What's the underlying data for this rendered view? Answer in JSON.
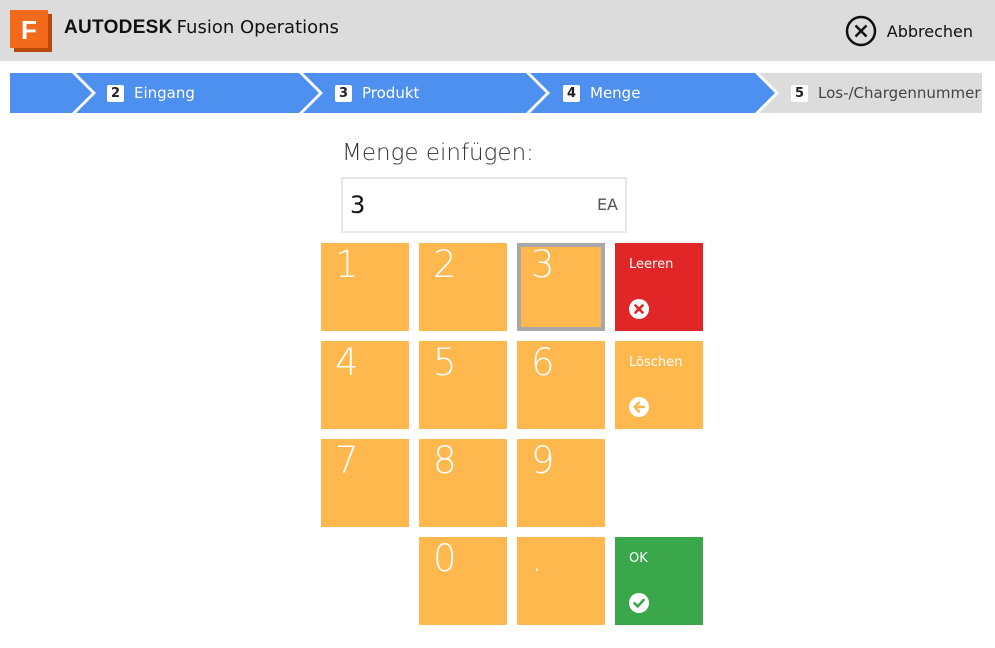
{
  "header": {
    "brand": "AUTODESK",
    "product": "Fusion Operations",
    "logo_letter": "F",
    "cancel_label": "Abbrechen"
  },
  "steps": [
    {
      "number": "2",
      "label": "Eingang",
      "state": "done"
    },
    {
      "number": "3",
      "label": "Produkt",
      "state": "done"
    },
    {
      "number": "4",
      "label": "Menge",
      "state": "active"
    },
    {
      "number": "5",
      "label": "Los-/Chargennummer",
      "state": "upcoming"
    }
  ],
  "quantity": {
    "title": "Menge einfügen:",
    "value": "3",
    "unit": "EA"
  },
  "keypad": {
    "keys": [
      "1",
      "2",
      "3",
      "4",
      "5",
      "6",
      "7",
      "8",
      "9",
      "0",
      "."
    ],
    "selected_key": "3",
    "clear_label": "Leeren",
    "delete_label": "Löschen",
    "ok_label": "OK"
  },
  "colors": {
    "header_bg": "#dcdcdc",
    "step_active": "#4d90f0",
    "step_inactive": "#dcdcdc",
    "key": "#ffb84d",
    "clear": "#e02626",
    "ok": "#3aa84a",
    "logo": "#f26a1b"
  }
}
